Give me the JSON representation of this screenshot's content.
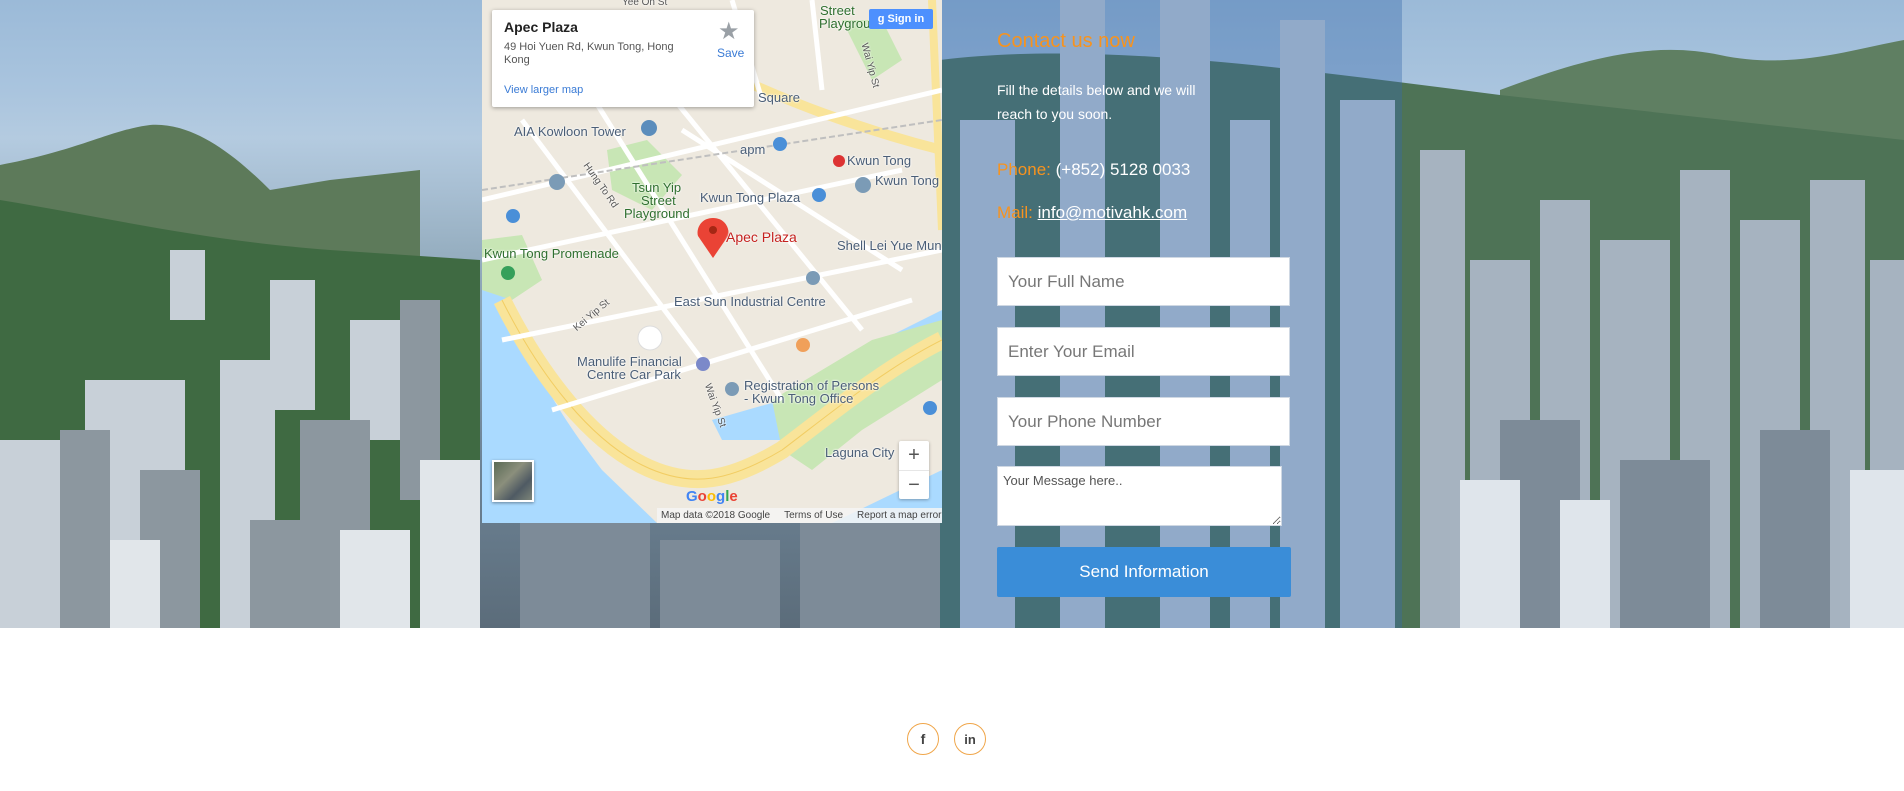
{
  "map": {
    "place_name": "Apec Plaza",
    "address": "49 Hoi Yuen Rd, Kwun Tong, Hong Kong",
    "save_label": "Save",
    "view_larger": "View larger map",
    "sign_in": "Sign in",
    "pin_label": "Apec Plaza",
    "labels": {
      "aia": "AIA Kowloon Tower",
      "apm": "apm",
      "kwun_tong": "Kwun Tong",
      "kwun_tong_ind": "Kwun Tong Industrial Ce",
      "tsun_yip_1": "Tsun Yip",
      "tsun_yip_2": "Street",
      "tsun_yip_3": "Playground",
      "kt_plaza": "Kwun Tong Plaza",
      "promenade": "Kwun Tong Promenade",
      "shell": "Shell Lei Yue Mun",
      "east_sun": "East Sun Industrial Centre",
      "manulife_1": "Manulife Financial",
      "manulife_2": "Centre Car Park",
      "registration_1": "Registration of Persons",
      "registration_2": "- Kwun Tong Office",
      "laguna": "Laguna City",
      "square": "Square",
      "street_pg_1": "Street",
      "street_pg_2": "Playground",
      "wai_yip": "Wai Yip St",
      "hung_to": "Hung To Rd",
      "kei_yip": "Kei Yip St",
      "yee_on": "Yee On St",
      "wai_yip_top": "Wai Yip St"
    },
    "zoom_in": "+",
    "zoom_out": "−",
    "google": "Google",
    "map_data": "Map data ©2018 Google",
    "terms": "Terms of Use",
    "report": "Report a map error"
  },
  "contact": {
    "title": "Contact us now",
    "subtitle": "Fill the details below and we will reach to you soon.",
    "phone_label": "Phone:",
    "phone_value": "(+852) 5128 0033",
    "mail_label": "Mail:",
    "mail_value": "info@motivahk.com",
    "name_placeholder": "Your Full Name",
    "email_placeholder": "Enter Your Email",
    "phone_placeholder": "Your Phone Number",
    "message_placeholder": "Your Message here..",
    "send_label": "Send Information"
  },
  "social": {
    "facebook": "f",
    "linkedin": "in"
  },
  "colors": {
    "accent": "#f7931e",
    "button": "#3a8dd8",
    "link_blue": "#3a7bd5"
  }
}
